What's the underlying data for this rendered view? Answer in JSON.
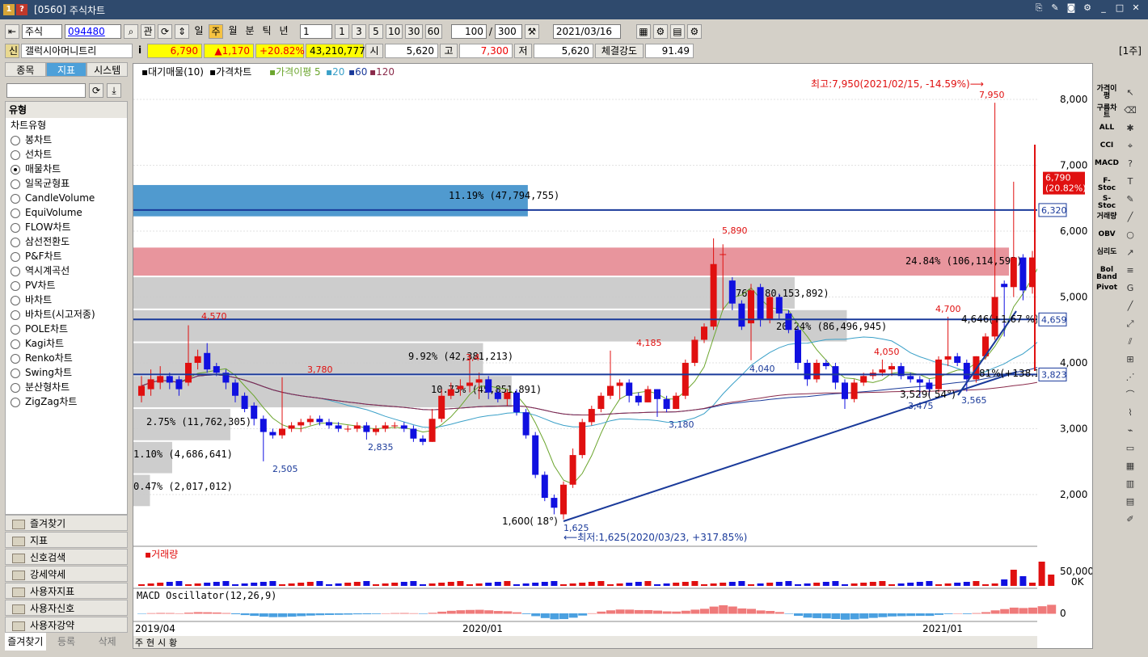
{
  "window": {
    "code": "[0560]",
    "title": "주식차트",
    "icon1": "1",
    "icon2": "?"
  },
  "toolbar": {
    "market": "주식",
    "code": "094480",
    "kwan": "관",
    "periods": [
      "일",
      "주",
      "월",
      "분",
      "틱",
      "년"
    ],
    "count": "1",
    "nums": [
      "1",
      "3",
      "5",
      "10",
      "30",
      "60"
    ],
    "view": "100",
    "total": "300",
    "date": "2021/03/16"
  },
  "quote": {
    "tag": "신",
    "name": "갤럭시아머니트리",
    "price": "6,790",
    "change": "▲1,170",
    "rate": "+20.82%",
    "volume": "43,210,777",
    "open_label": "시",
    "open": "5,620",
    "high_label": "고",
    "high": "7,300",
    "low_label": "저",
    "low": "5,620",
    "strength_label": "체결강도",
    "strength": "91.49",
    "period_badge": "[1주]"
  },
  "left": {
    "tabs": [
      "종목",
      "지표",
      "시스템"
    ],
    "type_header": "유형",
    "chart_type_group": "차트유형",
    "types": [
      "봉차트",
      "선차트",
      "매물차트",
      "일목균형표",
      "CandleVolume",
      "EquiVolume",
      "FLOW차트",
      "삼선전환도",
      "P&F차트",
      "역시계곡선",
      "PV차트",
      "바차트",
      "바차트(시고저종)",
      "POLE차트",
      "Kagi차트",
      "Renko차트",
      "Swing차트",
      "분산형차트",
      "ZigZag차트"
    ],
    "selected_index": 2,
    "categories": [
      "즐겨찾기",
      "지표",
      "신호검색",
      "강세약세",
      "사용자지표",
      "사용자신호",
      "사용자강약"
    ],
    "bottom_tabs": [
      "즐겨찾기",
      "등록",
      "삭제"
    ]
  },
  "legend": {
    "items": [
      "▪대기매물(10)",
      "▪가격차트",
      "▪가격이평",
      "5",
      "▪20",
      "▪60",
      "▪120"
    ]
  },
  "annotations": {
    "max": "최고:7,950(2021/02/15, -14.59%)⟶",
    "min": "⟵최저:1,625(2020/03/23, +317.85%)",
    "angle1": "1,600( 18°)",
    "angle2": "3,529( 54°)",
    "r138": "81%(+138.13 %)",
    "r1867": "4,646(+1.67 %)"
  },
  "price_labels": [
    "4,570",
    "3,780",
    "2,505",
    "2,835",
    "4,185",
    "5,890",
    "4,040",
    "3,180",
    "1,625",
    "4,700",
    "4,050",
    "3,475",
    "3,565",
    "7,950",
    "3,4"
  ],
  "volume_profile": [
    {
      "label": "11.19% (47,794,755)",
      "pct": 11.19,
      "vmin": 6200,
      "vmax": 6700,
      "color": "#3d8fca"
    },
    {
      "label": "24.84% (106,114,595)",
      "pct": 24.84,
      "vmin": 5300,
      "vmax": 5750,
      "color": "#e68a92"
    },
    {
      "label": "76% (80,153,892)",
      "pct": 18.76,
      "vmin": 4800,
      "vmax": 5300,
      "color": "#c8c8c8"
    },
    {
      "label": "20.24% (86,496,945)",
      "pct": 20.24,
      "vmin": 4300,
      "vmax": 4800,
      "color": "#c8c8c8"
    },
    {
      "label": "9.92% (42,381,213)",
      "pct": 9.92,
      "vmin": 3800,
      "vmax": 4300,
      "color": "#c8c8c8"
    },
    {
      "label": "10.73% (45,851,891)",
      "pct": 10.73,
      "vmin": 3300,
      "vmax": 3800,
      "color": "#c8c8c8"
    },
    {
      "label": "2.75% (11,762,305)",
      "pct": 2.75,
      "vmin": 2800,
      "vmax": 3300,
      "color": "#c8c8c8"
    },
    {
      "label": "1.10% (4,686,641)",
      "pct": 1.1,
      "vmin": 2300,
      "vmax": 2800,
      "color": "#c8c8c8"
    },
    {
      "label": "0.47% (2,017,012)",
      "pct": 0.47,
      "vmin": 1800,
      "vmax": 2300,
      "color": "#c8c8c8"
    }
  ],
  "hlines": [
    {
      "label": "6,320",
      "value": 6320
    },
    {
      "label": "4,659",
      "value": 4659
    },
    {
      "label": "3,823",
      "value": 3823
    }
  ],
  "last_price_tag": {
    "price": "6,790",
    "rate": "(20.82%)"
  },
  "y_axis": {
    "ticks": [
      "8,000",
      "7,000",
      "6,000",
      "5,000",
      "4,000",
      "3,000",
      "2,000"
    ]
  },
  "volume_panel": {
    "title": "▪거래량",
    "ticks": [
      "50,000K",
      "0K"
    ]
  },
  "macd_panel": {
    "title": "MACD Oscillator(12,26,9)",
    "tick": "0"
  },
  "x_axis": {
    "labels": [
      "2019/04",
      "2020/01",
      "2021/01"
    ]
  },
  "bottom_tabs": [
    "주",
    "현",
    "시",
    "황"
  ],
  "right_tools": [
    "가격이평",
    "구름차트",
    "ALL",
    "CCI",
    "MACD",
    "F-Stoc",
    "S-Stoc",
    "거래량",
    "OBV",
    "심리도",
    "Bol Band",
    "Pivot"
  ],
  "chart_data": {
    "type": "candlestick",
    "title": "",
    "ylim": [
      1500,
      8300
    ],
    "close": [
      3650,
      3750,
      3800,
      3700,
      3600,
      4000,
      4100,
      3900,
      3850,
      3700,
      3500,
      3300,
      3150,
      2950,
      2900,
      3000,
      3050,
      3100,
      3150,
      3100,
      3050,
      3000,
      3000,
      3050,
      2950,
      3000,
      3050,
      3050,
      3000,
      2850,
      2800,
      3150,
      3500,
      3600,
      3650,
      3700,
      3750,
      3550,
      3450,
      3550,
      3250,
      2900,
      2300,
      1950,
      1800,
      2150,
      2600,
      3100,
      3300,
      3500,
      3650,
      3700,
      3500,
      3400,
      3600,
      3450,
      3300,
      3500,
      4000,
      4350,
      4550,
      5500,
      5650,
      4900,
      4550,
      5100,
      4650,
      5000,
      4750,
      4500,
      4000,
      3750,
      4000,
      3950,
      3700,
      3450,
      3700,
      3800,
      3850,
      3900,
      3950,
      3800,
      3750,
      3700,
      3600,
      4050,
      4100,
      4000,
      3750,
      4100,
      4400,
      5000,
      5150,
      5600,
      5100,
      5600,
      6300,
      6790
    ],
    "open": [
      3500,
      3600,
      3700,
      3800,
      3750,
      3700,
      4000,
      4150,
      3950,
      3850,
      3700,
      3500,
      3350,
      3150,
      2950,
      2900,
      3000,
      3050,
      3100,
      3150,
      3100,
      3050,
      3000,
      3000,
      3050,
      2950,
      3000,
      3050,
      3050,
      3000,
      2850,
      2800,
      3150,
      3500,
      3600,
      3650,
      3700,
      3750,
      3550,
      3450,
      3550,
      3250,
      2900,
      2300,
      1950,
      1700,
      2150,
      2600,
      3100,
      3300,
      3500,
      3650,
      3700,
      3500,
      3400,
      3600,
      3450,
      3300,
      3500,
      4000,
      4350,
      4550,
      5650,
      5250,
      4900,
      4600,
      5150,
      4650,
      5000,
      4750,
      4500,
      4000,
      3750,
      4000,
      3950,
      3700,
      3450,
      3700,
      3800,
      3850,
      3900,
      3950,
      3800,
      3750,
      3700,
      3600,
      4050,
      4100,
      4000,
      3750,
      4100,
      4400,
      5200,
      5150,
      5600,
      5150,
      5600,
      5620
    ],
    "high": [
      3800,
      3900,
      3950,
      3850,
      3800,
      4570,
      4200,
      4300,
      4000,
      3900,
      3750,
      3550,
      3400,
      3200,
      3000,
      3780,
      3100,
      3150,
      3200,
      3200,
      3150,
      3100,
      3050,
      3100,
      3100,
      3050,
      3100,
      3100,
      3100,
      3050,
      2900,
      3300,
      3600,
      3700,
      3750,
      4100,
      3850,
      3800,
      3600,
      3600,
      3600,
      3300,
      2950,
      2350,
      2000,
      2200,
      2700,
      3150,
      3350,
      3550,
      4185,
      3750,
      3750,
      3550,
      3650,
      3600,
      3500,
      3550,
      4050,
      4400,
      4600,
      5890,
      5800,
      5300,
      4950,
      5200,
      5200,
      5050,
      5050,
      4800,
      4550,
      4050,
      4050,
      4050,
      4000,
      3750,
      3750,
      3850,
      3900,
      4050,
      4000,
      4000,
      3850,
      3800,
      3750,
      4100,
      4700,
      4150,
      4050,
      4100,
      4450,
      7950,
      5250,
      6750,
      5650,
      5700,
      7300,
      7300
    ],
    "low": [
      3400,
      3500,
      3600,
      3600,
      3500,
      3650,
      3900,
      3850,
      3800,
      3600,
      3400,
      3250,
      3050,
      2505,
      2850,
      2850,
      2950,
      2950,
      3050,
      3050,
      3000,
      2950,
      2950,
      2950,
      2835,
      2900,
      2950,
      3000,
      2950,
      2800,
      2750,
      2800,
      3100,
      3450,
      3500,
      3550,
      3450,
      3450,
      3400,
      3350,
      3200,
      2850,
      2250,
      1900,
      1700,
      1625,
      2100,
      2550,
      3050,
      3250,
      3450,
      3450,
      3400,
      3350,
      3400,
      3180,
      3250,
      3300,
      3450,
      3950,
      4300,
      4500,
      4800,
      4800,
      4500,
      4040,
      4550,
      4600,
      4650,
      4450,
      3900,
      3650,
      3700,
      3900,
      3600,
      3300,
      3400,
      3650,
      3750,
      3800,
      3800,
      3750,
      3700,
      3475,
      3500,
      3550,
      3950,
      3950,
      3565,
      3700,
      4050,
      4350,
      4400,
      5000,
      4950,
      5050,
      5600,
      5620
    ]
  }
}
